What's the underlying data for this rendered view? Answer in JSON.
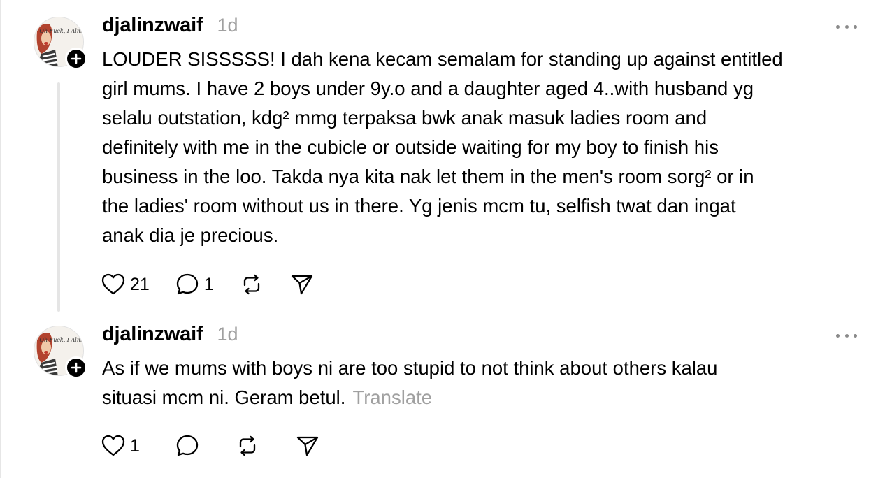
{
  "posts": [
    {
      "username": "djalinzwaif",
      "time": "1d",
      "avatar_text": "Oh Fuck, I Almost",
      "lines": [
        "LOUDER SISSSSS! I dah kena kecam semalam for standing up against entitled",
        "girl mums. I have 2 boys under 9y.o and a daughter aged 4..with husband yg",
        "selalu outstation, kdg² mmg terpaksa bwk anak masuk ladies room and",
        "definitely with me in the cubicle or outside waiting for my boy to finish his",
        "business in the loo. Takda nya kita nak let them in the men's room sorg² or in",
        "the ladies' room without us in there. Yg jenis mcm tu, selfish twat dan ingat",
        "anak dia je precious."
      ],
      "likes": "21",
      "replies": "1",
      "icons": [
        "heart-icon",
        "comment-icon",
        "repost-icon",
        "share-icon",
        "more-icon",
        "plus-icon"
      ]
    },
    {
      "username": "djalinzwaif",
      "time": "1d",
      "avatar_text": "Oh Fuck, I Almost",
      "lines": [
        "As if we mums with boys ni are too stupid to not think about others kalau",
        "situasi mcm ni. Geram betul."
      ],
      "translate": "Translate",
      "likes": "1",
      "icons": [
        "heart-icon",
        "comment-icon",
        "repost-icon",
        "share-icon",
        "more-icon",
        "plus-icon"
      ]
    }
  ]
}
